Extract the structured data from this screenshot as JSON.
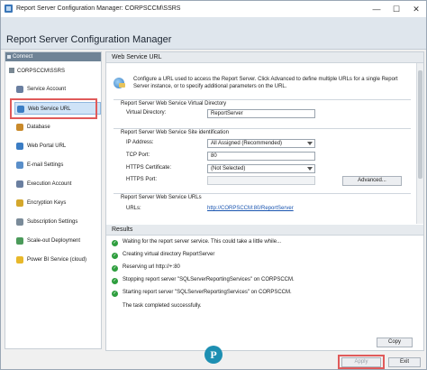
{
  "window": {
    "title": "Report Server Configuration Manager: CORPSCCM\\SSRS",
    "controls": {
      "minimize": "—",
      "maximize": "☐",
      "close": "✕"
    }
  },
  "header": {
    "title": "Report Server Configuration Manager"
  },
  "sidebar": {
    "header": "Connect",
    "server": "CORPSCCM\\SSRS",
    "items": [
      {
        "label": "Service Account",
        "icon": "service-account-icon",
        "color": "#6a7fa0"
      },
      {
        "label": "Web Service URL",
        "icon": "web-service-url-icon",
        "color": "#3b7dc4",
        "selected": true
      },
      {
        "label": "Database",
        "icon": "database-icon",
        "color": "#c98a2b"
      },
      {
        "label": "Web Portal URL",
        "icon": "web-portal-url-icon",
        "color": "#3b7dc4"
      },
      {
        "label": "E-mail Settings",
        "icon": "email-icon",
        "color": "#5a8fc9"
      },
      {
        "label": "Execution Account",
        "icon": "execution-account-icon",
        "color": "#6a7fa0"
      },
      {
        "label": "Encryption Keys",
        "icon": "encryption-keys-icon",
        "color": "#d4a72c"
      },
      {
        "label": "Subscription Settings",
        "icon": "subscription-settings-icon",
        "color": "#7a8b99"
      },
      {
        "label": "Scale-out Deployment",
        "icon": "scale-out-icon",
        "color": "#4b9a5a"
      },
      {
        "label": "Power BI Service (cloud)",
        "icon": "power-bi-icon",
        "color": "#e8b82a"
      }
    ]
  },
  "main": {
    "section_title": "Web Service URL",
    "description": "Configure a URL used to access the Report Server. Click Advanced to define multiple URLs for a single Report Server instance, or to specify additional parameters on the URL.",
    "vdir": {
      "group_title": "Report Server Web Service Virtual Directory",
      "label": "Virtual Directory:",
      "value": "ReportServer"
    },
    "site": {
      "group_title": "Report Server Web Service Site identification",
      "ip_label": "IP Address:",
      "ip_value": "All Assigned (Recommended)",
      "tcp_label": "TCP Port:",
      "tcp_value": "80",
      "https_cert_label": "HTTPS Certificate:",
      "https_cert_value": "(Not Selected)",
      "https_port_label": "HTTPS Port:",
      "https_port_value": "",
      "advanced_label": "Advanced..."
    },
    "urls": {
      "group_title": "Report Server Web Service URLs",
      "label": "URLs:",
      "link": "http://CORPSCCM:80/ReportServer"
    }
  },
  "results": {
    "title": "Results",
    "rows": [
      "Waiting for the report server service. This could take a little while...",
      "Creating virtual directory ReportServer",
      "Reserving url http://+:80",
      "Stopping report server \"SQLServerReportingServices\" on CORPSCCM.",
      "Starting report server \"SQLServerReportingServices\" on CORPSCCM."
    ],
    "final": "The task completed successfully.",
    "copy_label": "Copy"
  },
  "footer": {
    "logo_letter": "P",
    "apply_label": "Apply",
    "exit_label": "Exit"
  },
  "colors": {
    "highlight": "#e05a5a",
    "success": "#2e9e3e",
    "link": "#1a55b0",
    "selection": "#cfe3f7"
  }
}
